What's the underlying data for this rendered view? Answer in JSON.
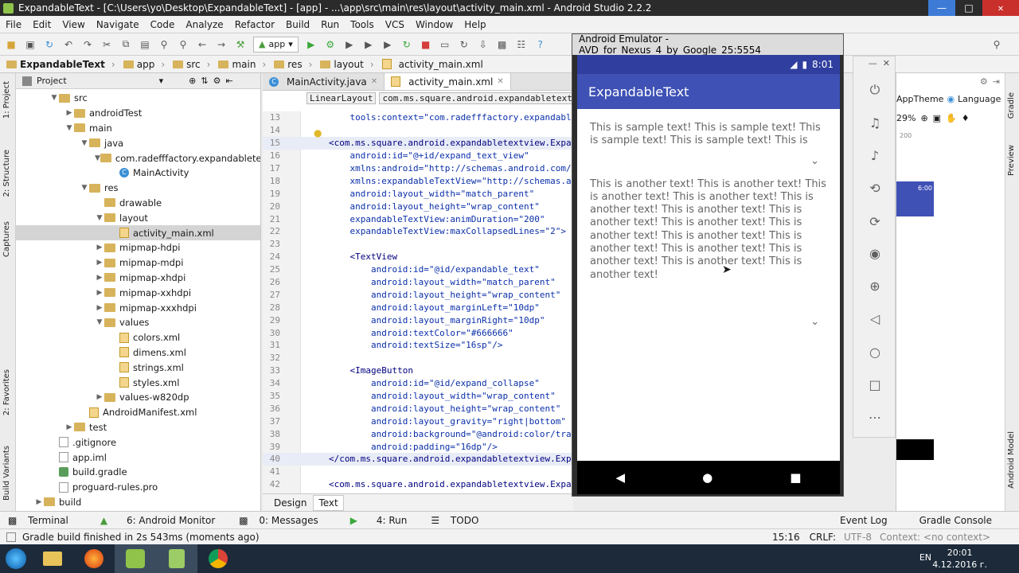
{
  "window": {
    "title": "ExpandableText - [C:\\Users\\yo\\Desktop\\ExpandableText] - [app] - ...\\app\\src\\main\\res\\layout\\activity_main.xml - Android Studio 2.2.2"
  },
  "menu": [
    "File",
    "Edit",
    "View",
    "Navigate",
    "Code",
    "Analyze",
    "Refactor",
    "Build",
    "Run",
    "Tools",
    "VCS",
    "Window",
    "Help"
  ],
  "toolbar": {
    "run_config": "app"
  },
  "breadcrumbs": [
    "ExpandableText",
    "app",
    "src",
    "main",
    "res",
    "layout",
    "activity_main.xml"
  ],
  "left_strip": {
    "project": "1: Project",
    "structure": "2: Structure",
    "captures": "Captures",
    "favorites": "2: Favorites",
    "variants": "Build Variants"
  },
  "project": {
    "header": "Project",
    "tree": [
      {
        "label": "src",
        "icon": "folder",
        "depth": 2,
        "arrow": "down"
      },
      {
        "label": "androidTest",
        "icon": "folder",
        "depth": 3,
        "arrow": "right"
      },
      {
        "label": "main",
        "icon": "folder",
        "depth": 3,
        "arrow": "down"
      },
      {
        "label": "java",
        "icon": "folder",
        "depth": 4,
        "arrow": "down"
      },
      {
        "label": "com.radefffactory.expandabletext",
        "icon": "folder",
        "depth": 5,
        "arrow": "down"
      },
      {
        "label": "MainActivity",
        "icon": "class",
        "depth": 6,
        "arrow": ""
      },
      {
        "label": "res",
        "icon": "folder",
        "depth": 4,
        "arrow": "down"
      },
      {
        "label": "drawable",
        "icon": "folder",
        "depth": 5,
        "arrow": ""
      },
      {
        "label": "layout",
        "icon": "folder",
        "depth": 5,
        "arrow": "down"
      },
      {
        "label": "activity_main.xml",
        "icon": "xml",
        "depth": 6,
        "arrow": "",
        "selected": true
      },
      {
        "label": "mipmap-hdpi",
        "icon": "folder",
        "depth": 5,
        "arrow": "right"
      },
      {
        "label": "mipmap-mdpi",
        "icon": "folder",
        "depth": 5,
        "arrow": "right"
      },
      {
        "label": "mipmap-xhdpi",
        "icon": "folder",
        "depth": 5,
        "arrow": "right"
      },
      {
        "label": "mipmap-xxhdpi",
        "icon": "folder",
        "depth": 5,
        "arrow": "right"
      },
      {
        "label": "mipmap-xxxhdpi",
        "icon": "folder",
        "depth": 5,
        "arrow": "right"
      },
      {
        "label": "values",
        "icon": "folder",
        "depth": 5,
        "arrow": "down"
      },
      {
        "label": "colors.xml",
        "icon": "xml",
        "depth": 6,
        "arrow": ""
      },
      {
        "label": "dimens.xml",
        "icon": "xml",
        "depth": 6,
        "arrow": ""
      },
      {
        "label": "strings.xml",
        "icon": "xml",
        "depth": 6,
        "arrow": ""
      },
      {
        "label": "styles.xml",
        "icon": "xml",
        "depth": 6,
        "arrow": ""
      },
      {
        "label": "values-w820dp",
        "icon": "folder",
        "depth": 5,
        "arrow": "right"
      },
      {
        "label": "AndroidManifest.xml",
        "icon": "xml",
        "depth": 4,
        "arrow": ""
      },
      {
        "label": "test",
        "icon": "folder",
        "depth": 3,
        "arrow": "right"
      },
      {
        "label": ".gitignore",
        "icon": "file",
        "depth": 2,
        "arrow": ""
      },
      {
        "label": "app.iml",
        "icon": "file",
        "depth": 2,
        "arrow": ""
      },
      {
        "label": "build.gradle",
        "icon": "gradle",
        "depth": 2,
        "arrow": ""
      },
      {
        "label": "proguard-rules.pro",
        "icon": "file",
        "depth": 2,
        "arrow": ""
      },
      {
        "label": "build",
        "icon": "folder",
        "depth": 1,
        "arrow": "right"
      }
    ]
  },
  "editor": {
    "tabs": [
      {
        "label": "MainActivity.java"
      },
      {
        "label": "activity_main.xml",
        "active": true
      }
    ],
    "crumbs": [
      "LinearLayout",
      "com.ms.square.android.expandabletext"
    ],
    "lines": [
      {
        "n": "13",
        "text": "    tools:context=\"com.radefffactory.expandabletex"
      },
      {
        "n": "14",
        "text": ""
      },
      {
        "n": "15",
        "text": "<com.ms.square.android.expandabletextview.Expan",
        "hl": true
      },
      {
        "n": "16",
        "text": "    android:id=\"@+id/expand_text_view\""
      },
      {
        "n": "17",
        "text": "    xmlns:android=\"http://schemas.android.com/a"
      },
      {
        "n": "18",
        "text": "    xmlns:expandableTextView=\"http://schemas.an"
      },
      {
        "n": "19",
        "text": "    android:layout_width=\"match_parent\""
      },
      {
        "n": "20",
        "text": "    android:layout_height=\"wrap_content\""
      },
      {
        "n": "21",
        "text": "    expandableTextView:animDuration=\"200\""
      },
      {
        "n": "22",
        "text": "    expandableTextView:maxCollapsedLines=\"2\">"
      },
      {
        "n": "23",
        "text": ""
      },
      {
        "n": "24",
        "text": "    <TextView"
      },
      {
        "n": "25",
        "text": "        android:id=\"@id/expandable_text\""
      },
      {
        "n": "26",
        "text": "        android:layout_width=\"match_parent\""
      },
      {
        "n": "27",
        "text": "        android:layout_height=\"wrap_content\""
      },
      {
        "n": "28",
        "text": "        android:layout_marginLeft=\"10dp\""
      },
      {
        "n": "29",
        "text": "        android:layout_marginRight=\"10dp\""
      },
      {
        "n": "30",
        "text": "        android:textColor=\"#666666\""
      },
      {
        "n": "31",
        "text": "        android:textSize=\"16sp\"/>"
      },
      {
        "n": "32",
        "text": ""
      },
      {
        "n": "33",
        "text": "    <ImageButton"
      },
      {
        "n": "34",
        "text": "        android:id=\"@id/expand_collapse\""
      },
      {
        "n": "35",
        "text": "        android:layout_width=\"wrap_content\""
      },
      {
        "n": "36",
        "text": "        android:layout_height=\"wrap_content\""
      },
      {
        "n": "37",
        "text": "        android:layout_gravity=\"right|bottom\""
      },
      {
        "n": "38",
        "text": "        android:background=\"@android:color/tran"
      },
      {
        "n": "39",
        "text": "        android:padding=\"16dp\"/>"
      },
      {
        "n": "40",
        "text": "</com.ms.square.android.expandabletextview.Expa",
        "hl": true
      },
      {
        "n": "41",
        "text": ""
      },
      {
        "n": "42",
        "text": "<com.ms.square.android.expandabletextview.Expan"
      }
    ],
    "design_tab": "Design",
    "text_tab": "Text"
  },
  "emulator": {
    "title": "Android Emulator - AVD_for_Nexus_4_by_Google_25:5554",
    "time": "8:01",
    "app_title": "ExpandableText",
    "text1": "This is sample text! This is sample text! This is sample text! This is sample text! This is",
    "text2": "This is another text! This is another text! This is another text! This is another text! This is another text! This is another text! This is another text! This is another text! This is another text! This is another text! This is another text! This is another text! This is another text! This is another text! This is another text!"
  },
  "design_preview": {
    "theme": "AppTheme",
    "language": "Language",
    "zoom": "29%",
    "ruler": "200",
    "time": "6:00"
  },
  "right_strip": {
    "gradle": "Gradle",
    "preview": "Preview",
    "model": "Android Model"
  },
  "bottom_tools": {
    "terminal": "Terminal",
    "monitor": "6: Android Monitor",
    "messages": "0: Messages",
    "run": "4: Run",
    "todo": "TODO",
    "eventlog": "Event Log",
    "console": "Gradle Console"
  },
  "status": {
    "message": "Gradle build finished in 2s 543ms (moments ago)",
    "position": "15:16",
    "crlf": "CRLF:",
    "encoding": "UTF-8",
    "context": "Context: <no context>"
  },
  "taskbar": {
    "lang": "EN",
    "time": "20:01",
    "date": "4.12.2016 г."
  }
}
